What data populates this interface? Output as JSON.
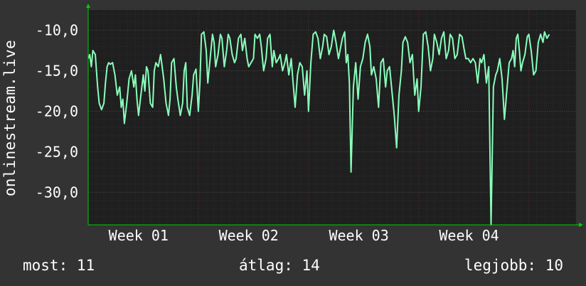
{
  "chart_data": {
    "type": "line",
    "ylabel": "onlinestream.live",
    "ylim": [
      -34,
      -7.5
    ],
    "yticks": [
      "-10,0",
      "-15,0",
      "-20,0",
      "-25,0",
      "-30,0"
    ],
    "ytick_values": [
      -10,
      -15,
      -20,
      -25,
      -30
    ],
    "x_range_days": [
      0,
      31
    ],
    "xtick_labels": [
      "Week 01",
      "Week 02",
      "Week 03",
      "Week 04"
    ],
    "xtick_centers_day": [
      3.2,
      10.2,
      17.2,
      24.2
    ],
    "week_boundaries_day": [
      7,
      14,
      21,
      28
    ],
    "grid": true,
    "series": [
      {
        "color": "#88ffbb",
        "x_day": [
          0.0,
          0.1,
          0.2,
          0.3,
          0.45,
          0.6,
          0.7,
          0.85,
          1.0,
          1.1,
          1.2,
          1.3,
          1.4,
          1.55,
          1.7,
          1.85,
          2.0,
          2.1,
          2.2,
          2.3,
          2.45,
          2.6,
          2.75,
          2.9,
          3.0,
          3.1,
          3.2,
          3.35,
          3.5,
          3.6,
          3.7,
          3.8,
          3.95,
          4.1,
          4.2,
          4.3,
          4.45,
          4.6,
          4.7,
          4.8,
          4.95,
          5.1,
          5.2,
          5.3,
          5.45,
          5.6,
          5.7,
          5.85,
          6.0,
          6.1,
          6.2,
          6.3,
          6.45,
          6.6,
          6.7,
          6.85,
          7.0,
          7.1,
          7.2,
          7.35,
          7.5,
          7.6,
          7.75,
          7.9,
          8.0,
          8.1,
          8.25,
          8.4,
          8.5,
          8.65,
          8.8,
          8.9,
          9.0,
          9.15,
          9.3,
          9.4,
          9.55,
          9.7,
          9.8,
          9.95,
          10.1,
          10.2,
          10.35,
          10.5,
          10.6,
          10.75,
          10.9,
          11.0,
          11.15,
          11.3,
          11.4,
          11.55,
          11.7,
          11.8,
          11.95,
          12.1,
          12.2,
          12.35,
          12.5,
          12.6,
          12.75,
          12.9,
          13.0,
          13.15,
          13.3,
          13.45,
          13.6,
          13.75,
          13.9,
          14.0,
          14.15,
          14.3,
          14.45,
          14.6,
          14.75,
          14.9,
          15.0,
          15.15,
          15.3,
          15.45,
          15.6,
          15.75,
          15.9,
          16.0,
          16.15,
          16.3,
          16.4,
          16.5,
          16.6,
          16.7,
          16.85,
          17.0,
          17.15,
          17.3,
          17.45,
          17.6,
          17.75,
          17.9,
          18.0,
          18.15,
          18.3,
          18.45,
          18.6,
          18.75,
          18.9,
          19.0,
          19.15,
          19.3,
          19.45,
          19.6,
          19.75,
          19.9,
          20.0,
          20.15,
          20.3,
          20.45,
          20.6,
          20.75,
          20.9,
          21.0,
          21.15,
          21.3,
          21.45,
          21.6,
          21.75,
          21.9,
          22.0,
          22.15,
          22.3,
          22.45,
          22.6,
          22.75,
          22.9,
          23.0,
          23.15,
          23.3,
          23.45,
          23.6,
          23.75,
          23.9,
          24.0,
          24.15,
          24.3,
          24.45,
          24.6,
          24.75,
          24.9,
          25.0,
          25.15,
          25.3,
          25.45,
          25.6,
          25.75,
          25.9,
          26.0,
          26.15,
          26.3,
          26.45,
          26.6,
          26.75,
          26.9,
          27.0,
          27.1,
          27.2,
          27.3,
          27.4,
          27.5,
          27.6,
          27.75,
          27.9,
          28.0,
          28.15,
          28.3,
          28.45,
          28.6,
          28.75,
          28.9,
          29.0,
          29.15,
          29.3,
          29.45,
          29.6,
          29.75,
          29.9,
          30.0,
          30.15,
          30.3,
          30.45,
          30.6,
          30.75,
          30.9,
          31.0
        ],
        "y": [
          -13.5,
          -13.0,
          -14.5,
          -12.5,
          -13.0,
          -17.0,
          -19.0,
          -19.8,
          -19.0,
          -16.5,
          -14.5,
          -14.0,
          -14.2,
          -14.0,
          -15.5,
          -18.0,
          -17.0,
          -19.5,
          -18.5,
          -21.5,
          -19.0,
          -16.0,
          -15.0,
          -17.0,
          -15.5,
          -18.5,
          -20.5,
          -18.0,
          -15.5,
          -17.5,
          -14.5,
          -15.0,
          -19.0,
          -19.5,
          -15.0,
          -14.0,
          -14.5,
          -13.0,
          -14.5,
          -16.0,
          -19.0,
          -20.5,
          -18.5,
          -14.0,
          -13.5,
          -17.0,
          -18.5,
          -20.5,
          -19.0,
          -15.0,
          -14.0,
          -19.5,
          -20.5,
          -18.0,
          -15.5,
          -14.8,
          -20.0,
          -16.5,
          -10.5,
          -10.2,
          -12.5,
          -16.5,
          -13.5,
          -10.5,
          -11.5,
          -14.5,
          -13.0,
          -10.5,
          -11.0,
          -14.5,
          -12.5,
          -10.5,
          -11.0,
          -13.0,
          -14.0,
          -13.5,
          -11.0,
          -10.5,
          -12.5,
          -11.0,
          -13.5,
          -14.5,
          -14.0,
          -13.5,
          -10.5,
          -11.0,
          -10.5,
          -12.0,
          -15.0,
          -13.5,
          -11.0,
          -10.5,
          -14.5,
          -12.5,
          -14.0,
          -13.5,
          -13.0,
          -15.0,
          -14.0,
          -13.0,
          -15.5,
          -13.5,
          -16.0,
          -19.5,
          -15.5,
          -14.0,
          -14.5,
          -18.0,
          -15.0,
          -20.0,
          -14.0,
          -10.5,
          -10.2,
          -11.0,
          -13.5,
          -12.0,
          -10.5,
          -10.8,
          -13.0,
          -12.0,
          -10.0,
          -11.5,
          -13.5,
          -12.5,
          -11.0,
          -10.2,
          -14.0,
          -13.0,
          -16.5,
          -27.5,
          -17.0,
          -14.0,
          -18.5,
          -14.5,
          -13.5,
          -11.5,
          -10.5,
          -12.0,
          -15.5,
          -14.5,
          -16.0,
          -19.5,
          -14.0,
          -13.5,
          -17.0,
          -15.0,
          -14.5,
          -17.5,
          -20.5,
          -24.5,
          -18.0,
          -15.0,
          -11.5,
          -10.8,
          -11.5,
          -14.0,
          -13.0,
          -18.0,
          -16.0,
          -20.0,
          -17.0,
          -10.5,
          -10.2,
          -12.0,
          -15.0,
          -13.5,
          -10.5,
          -11.5,
          -13.0,
          -11.0,
          -10.2,
          -13.5,
          -12.5,
          -10.5,
          -11.0,
          -13.5,
          -13.0,
          -10.5,
          -10.8,
          -12.5,
          -13.5,
          -13.5,
          -14.0,
          -13.5,
          -14.0,
          -16.5,
          -13.5,
          -14.0,
          -13.0,
          -16.5,
          -14.5,
          -34.0,
          -17.0,
          -15.5,
          -15.0,
          -13.5,
          -16.0,
          -21.0,
          -17.5,
          -14.0,
          -13.5,
          -12.5,
          -14.5,
          -11.0,
          -10.5,
          -12.5,
          -15.0,
          -14.0,
          -13.0,
          -10.8,
          -10.5,
          -12.5,
          -15.5,
          -15.0,
          -11.5,
          -10.5,
          -11.5,
          -10.2,
          -11.0,
          -10.5
        ]
      }
    ]
  },
  "footer": {
    "now": "most: 11",
    "avg": "átlag: 14",
    "max": "legjobb: 10"
  },
  "colors": {
    "background": "#333333",
    "plot_bg": "#1f1f1f",
    "grid_minor": "#2e2e2e",
    "grid_major": "#4a4a4a",
    "week_line": "#5a2a2a",
    "arrow": "#00cc00",
    "text": "#ffffff"
  }
}
